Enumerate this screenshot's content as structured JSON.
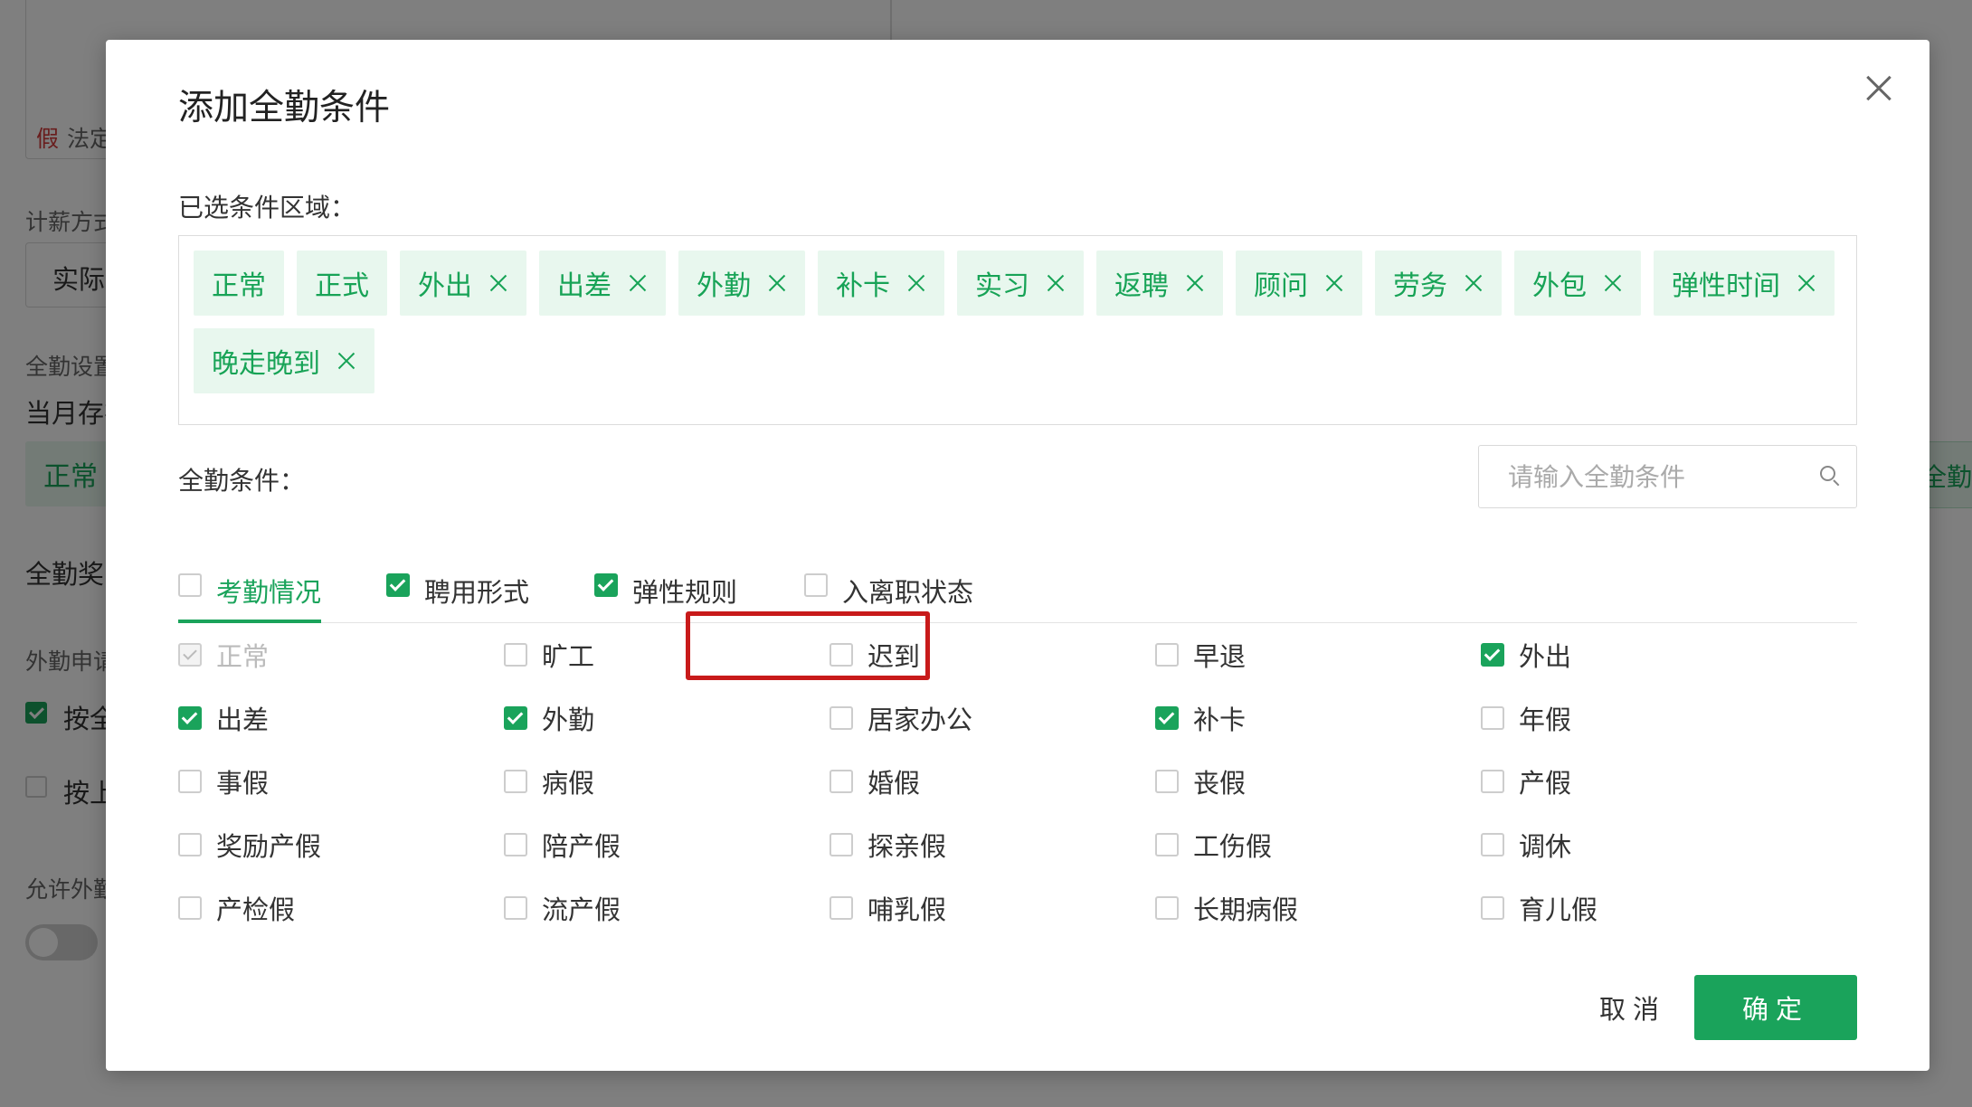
{
  "background": {
    "labels": {
      "holiday_prefix": "假",
      "holiday_text": "法定",
      "pay_method": "计薪方式",
      "pay_value": "实际",
      "attendance_settings": "全勤设置",
      "month_exists": "当月存在",
      "normal_tag": "正常",
      "attendance_bonus": "全勤奖",
      "field_apply": "外勤申请",
      "by_all": "按全",
      "by_upper": "按上",
      "allow_field": "允许外勤",
      "right_tag": "全勤条"
    }
  },
  "modal": {
    "title": "添加全勤条件",
    "selected_label": "已选条件区域：",
    "conditions_label": "全勤条件：",
    "search_placeholder": "请输入全勤条件",
    "selected_tags": [
      {
        "label": "正常",
        "removable": false
      },
      {
        "label": "正式",
        "removable": false
      },
      {
        "label": "外出",
        "removable": true
      },
      {
        "label": "出差",
        "removable": true
      },
      {
        "label": "外勤",
        "removable": true
      },
      {
        "label": "补卡",
        "removable": true
      },
      {
        "label": "实习",
        "removable": true
      },
      {
        "label": "返聘",
        "removable": true
      },
      {
        "label": "顾问",
        "removable": true
      },
      {
        "label": "劳务",
        "removable": true
      },
      {
        "label": "外包",
        "removable": true
      },
      {
        "label": "弹性时间",
        "removable": true
      },
      {
        "label": "晚走晚到",
        "removable": true
      }
    ],
    "tabs": [
      {
        "label": "考勤情况",
        "checked": false,
        "active": true
      },
      {
        "label": "聘用形式",
        "checked": true,
        "active": false
      },
      {
        "label": "弹性规则",
        "checked": true,
        "active": false
      },
      {
        "label": "入离职状态",
        "checked": false,
        "active": false
      }
    ],
    "options": [
      {
        "label": "正常",
        "state": "disabled"
      },
      {
        "label": "旷工",
        "state": "off"
      },
      {
        "label": "迟到",
        "state": "off"
      },
      {
        "label": "早退",
        "state": "off"
      },
      {
        "label": "外出",
        "state": "on"
      },
      {
        "label": "出差",
        "state": "on"
      },
      {
        "label": "外勤",
        "state": "on"
      },
      {
        "label": "居家办公",
        "state": "off"
      },
      {
        "label": "补卡",
        "state": "on"
      },
      {
        "label": "年假",
        "state": "off"
      },
      {
        "label": "事假",
        "state": "off"
      },
      {
        "label": "病假",
        "state": "off"
      },
      {
        "label": "婚假",
        "state": "off"
      },
      {
        "label": "丧假",
        "state": "off"
      },
      {
        "label": "产假",
        "state": "off"
      },
      {
        "label": "奖励产假",
        "state": "off"
      },
      {
        "label": "陪产假",
        "state": "off"
      },
      {
        "label": "探亲假",
        "state": "off"
      },
      {
        "label": "工伤假",
        "state": "off"
      },
      {
        "label": "调休",
        "state": "off"
      },
      {
        "label": "产检假",
        "state": "off"
      },
      {
        "label": "流产假",
        "state": "off"
      },
      {
        "label": "哺乳假",
        "state": "off"
      },
      {
        "label": "长期病假",
        "state": "off"
      },
      {
        "label": "育儿假",
        "state": "off"
      }
    ],
    "cancel_label": "取消",
    "ok_label": "确定"
  },
  "colors": {
    "accent": "#1aa35b",
    "tag_bg": "#e8f7ee",
    "highlight": "#c81a1a"
  }
}
